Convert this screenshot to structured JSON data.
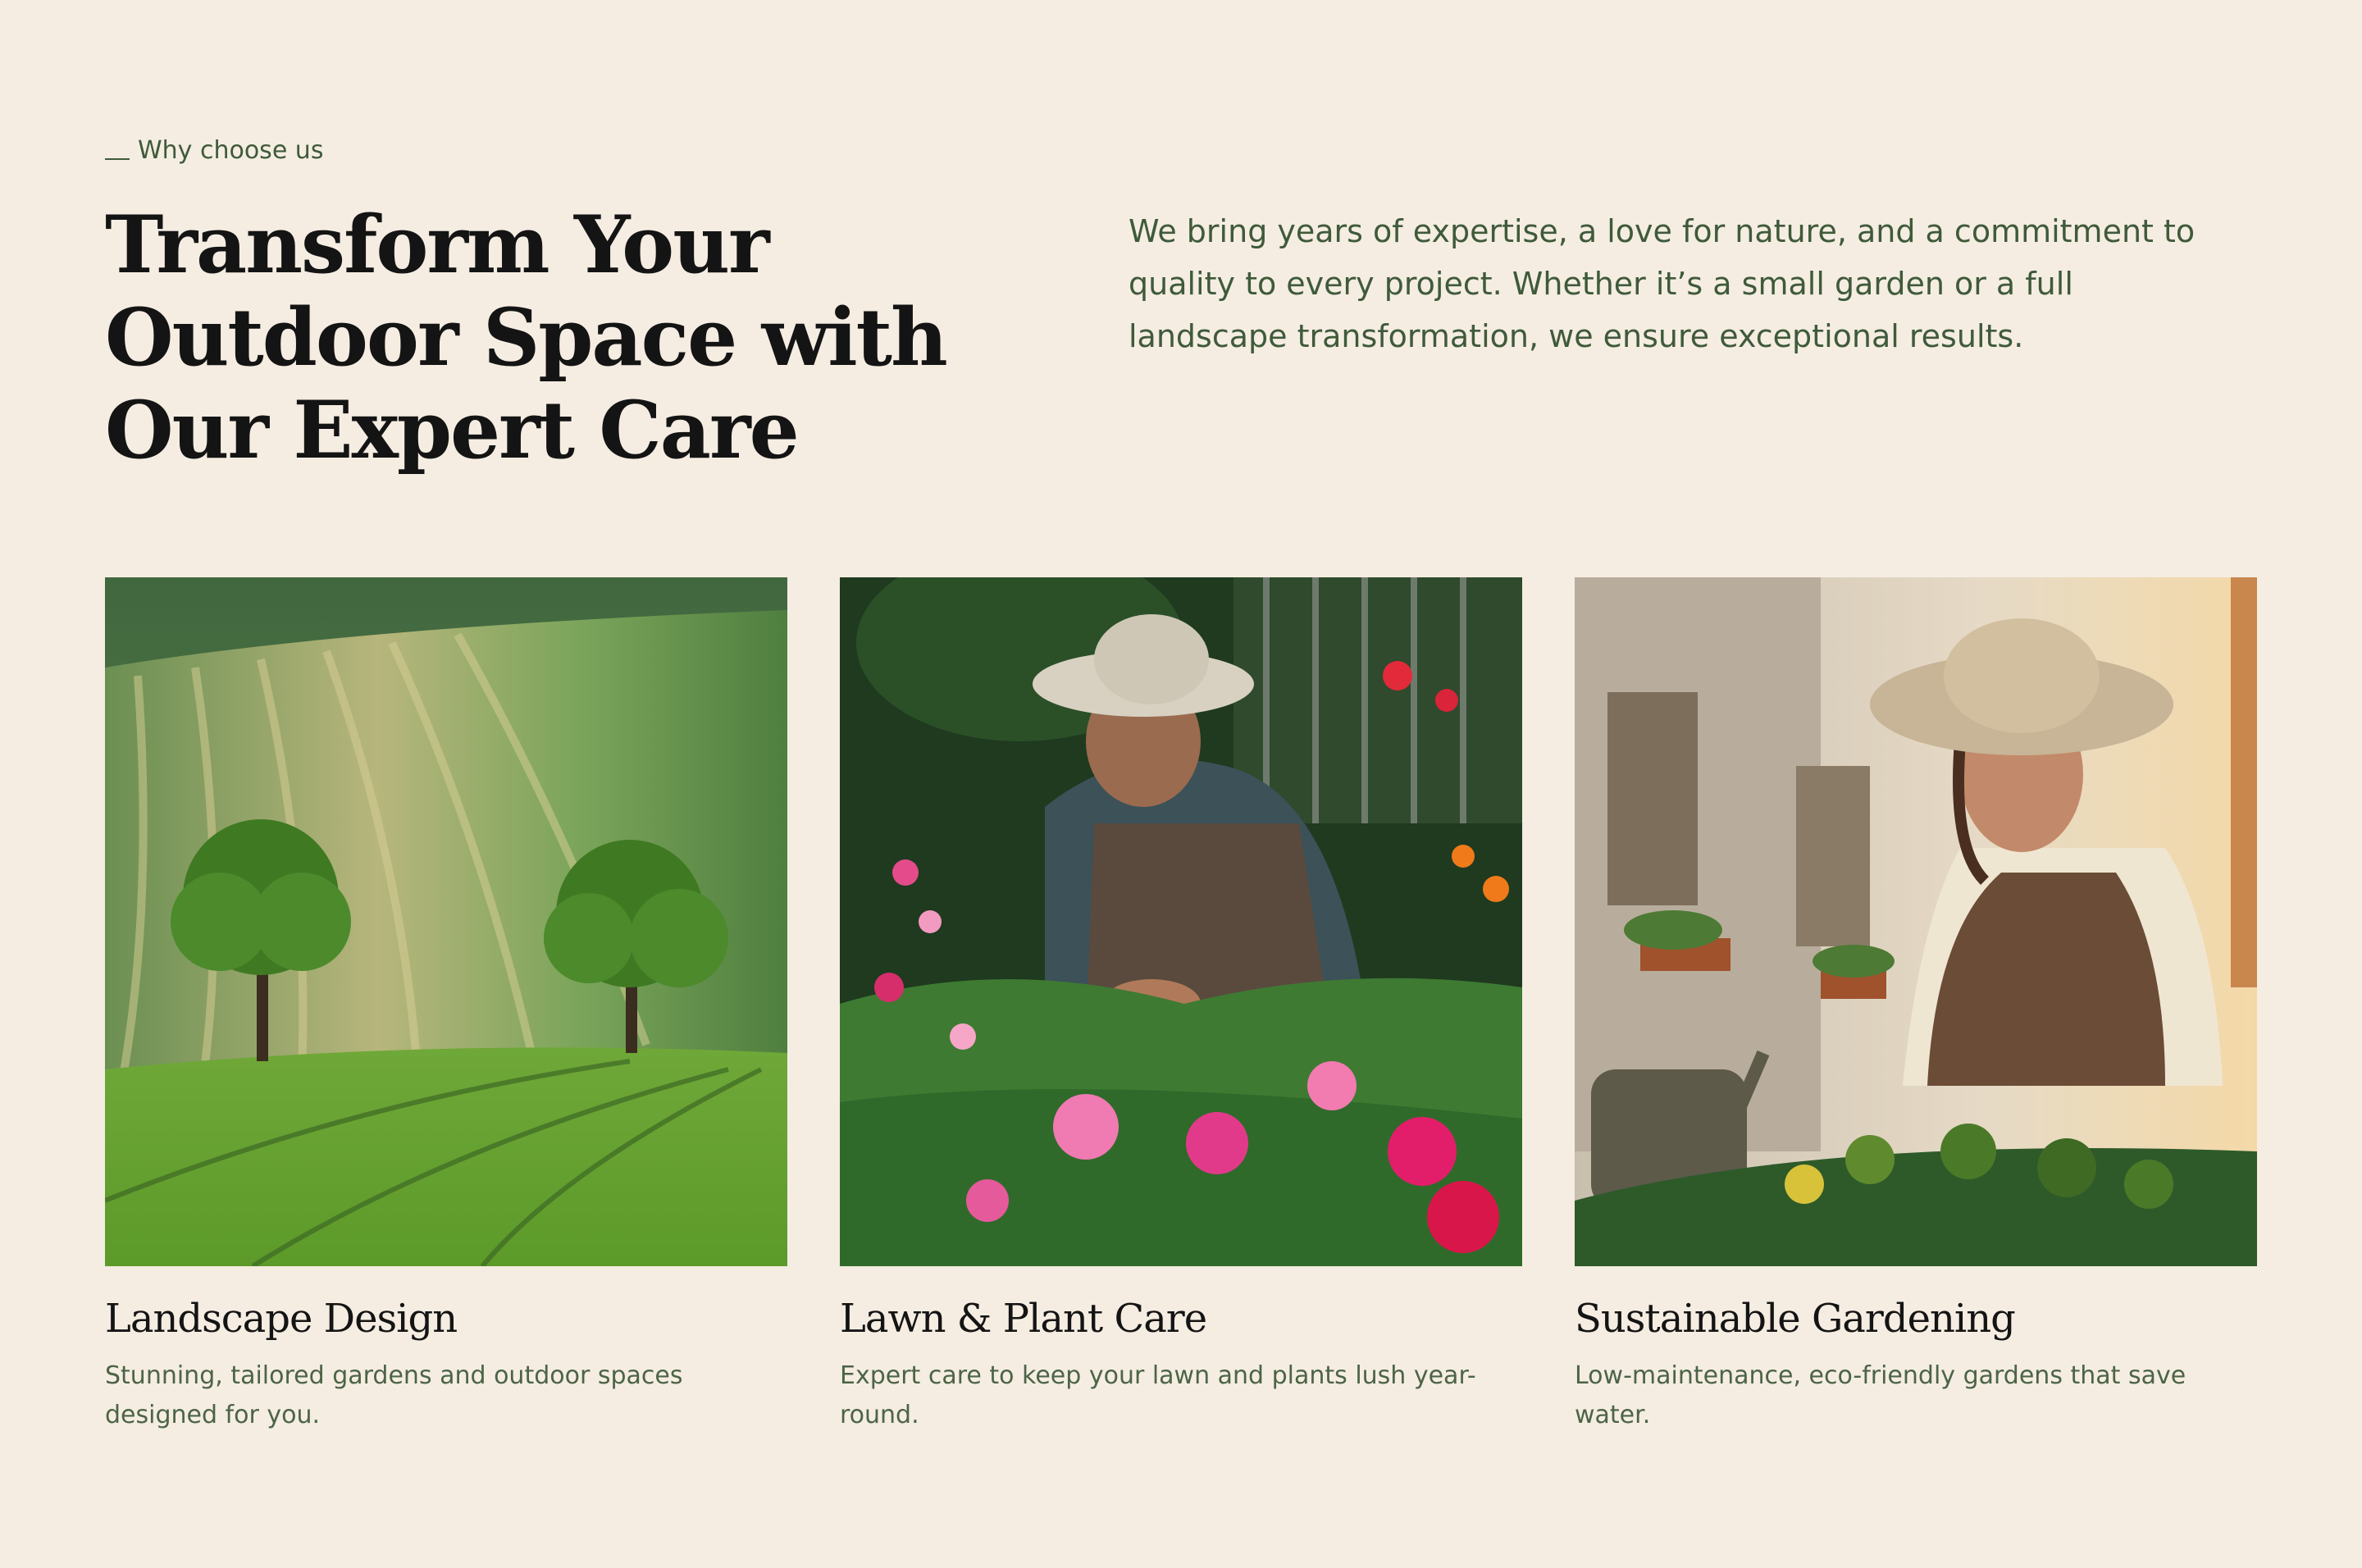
{
  "section": {
    "eyebrow": "Why choose us",
    "headline": "Transform Your Outdoor Space with Our Expert Care",
    "intro": "We bring years of expertise, a love for nature, and a commitment to quality to every project. Whether it’s a small garden or a full landscape transformation, we ensure exceptional results."
  },
  "cards": [
    {
      "title": "Landscape Design",
      "description": "Stunning, tailored gardens and outdoor spaces designed for you.",
      "image": "rolling-green-fields-with-trees"
    },
    {
      "title": "Lawn & Plant Care",
      "description": "Expert care to keep your lawn and plants lush year-round.",
      "image": "gardener-tending-flowers"
    },
    {
      "title": "Sustainable Gardening",
      "description": "Low-maintenance, eco-friendly gardens that save water.",
      "image": "woman-gardener-with-watering-can"
    }
  ],
  "colors": {
    "background": "#f5ede2",
    "accent_green": "#3f5a3a",
    "heading": "#141414"
  }
}
